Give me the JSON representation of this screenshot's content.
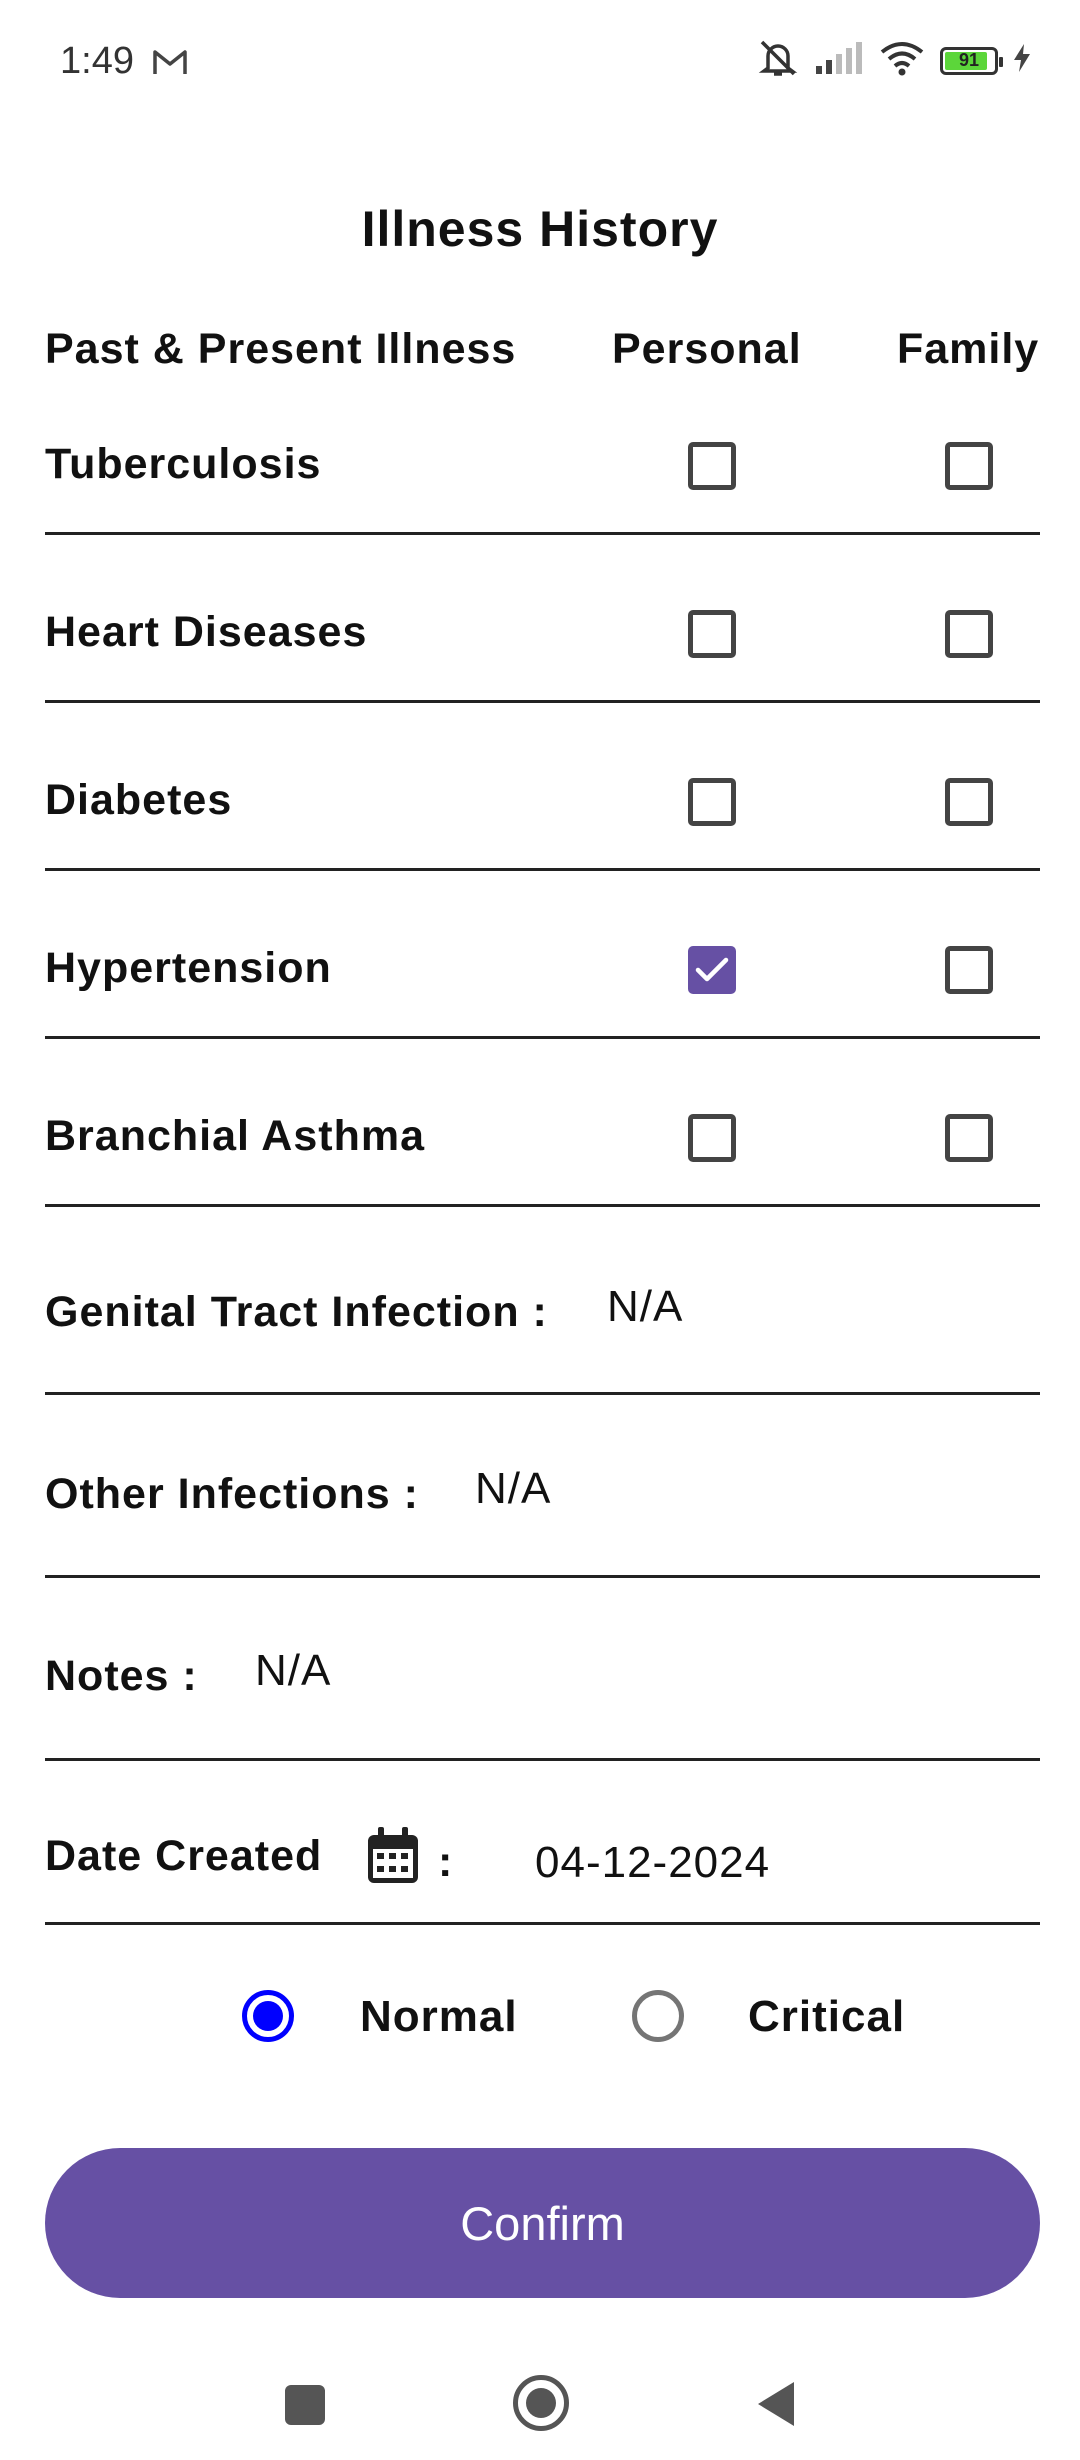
{
  "status_bar": {
    "time": "1:49",
    "battery": "91",
    "icons": [
      "gmail-icon",
      "mute-icon",
      "signal-icon",
      "wifi-icon",
      "battery-icon",
      "charging-icon"
    ]
  },
  "page": {
    "title": "Illness History"
  },
  "table": {
    "headers": {
      "illness": "Past & Present Illness",
      "personal": "Personal",
      "family": "Family"
    },
    "rows": [
      {
        "label": "Tuberculosis",
        "personal": false,
        "family": false
      },
      {
        "label": "Heart Diseases",
        "personal": false,
        "family": false
      },
      {
        "label": "Diabetes",
        "personal": false,
        "family": false
      },
      {
        "label": "Hypertension",
        "personal": true,
        "family": false
      },
      {
        "label": "Branchial Asthma",
        "personal": false,
        "family": false
      }
    ]
  },
  "fields": {
    "genital": {
      "label": "Genital Tract Infection :",
      "value": "N/A"
    },
    "other": {
      "label": "Other Infections :",
      "value": "N/A"
    },
    "notes": {
      "label": "Notes :",
      "value": "N/A"
    },
    "date": {
      "label": "Date Created",
      "colon": ":",
      "value": "04-12-2024"
    }
  },
  "severity": {
    "options": [
      {
        "label": "Normal",
        "selected": true
      },
      {
        "label": "Critical",
        "selected": false
      }
    ]
  },
  "actions": {
    "confirm_label": "Confirm"
  },
  "colors": {
    "accent": "#6650a4",
    "radio_selected": "#0000ff"
  }
}
